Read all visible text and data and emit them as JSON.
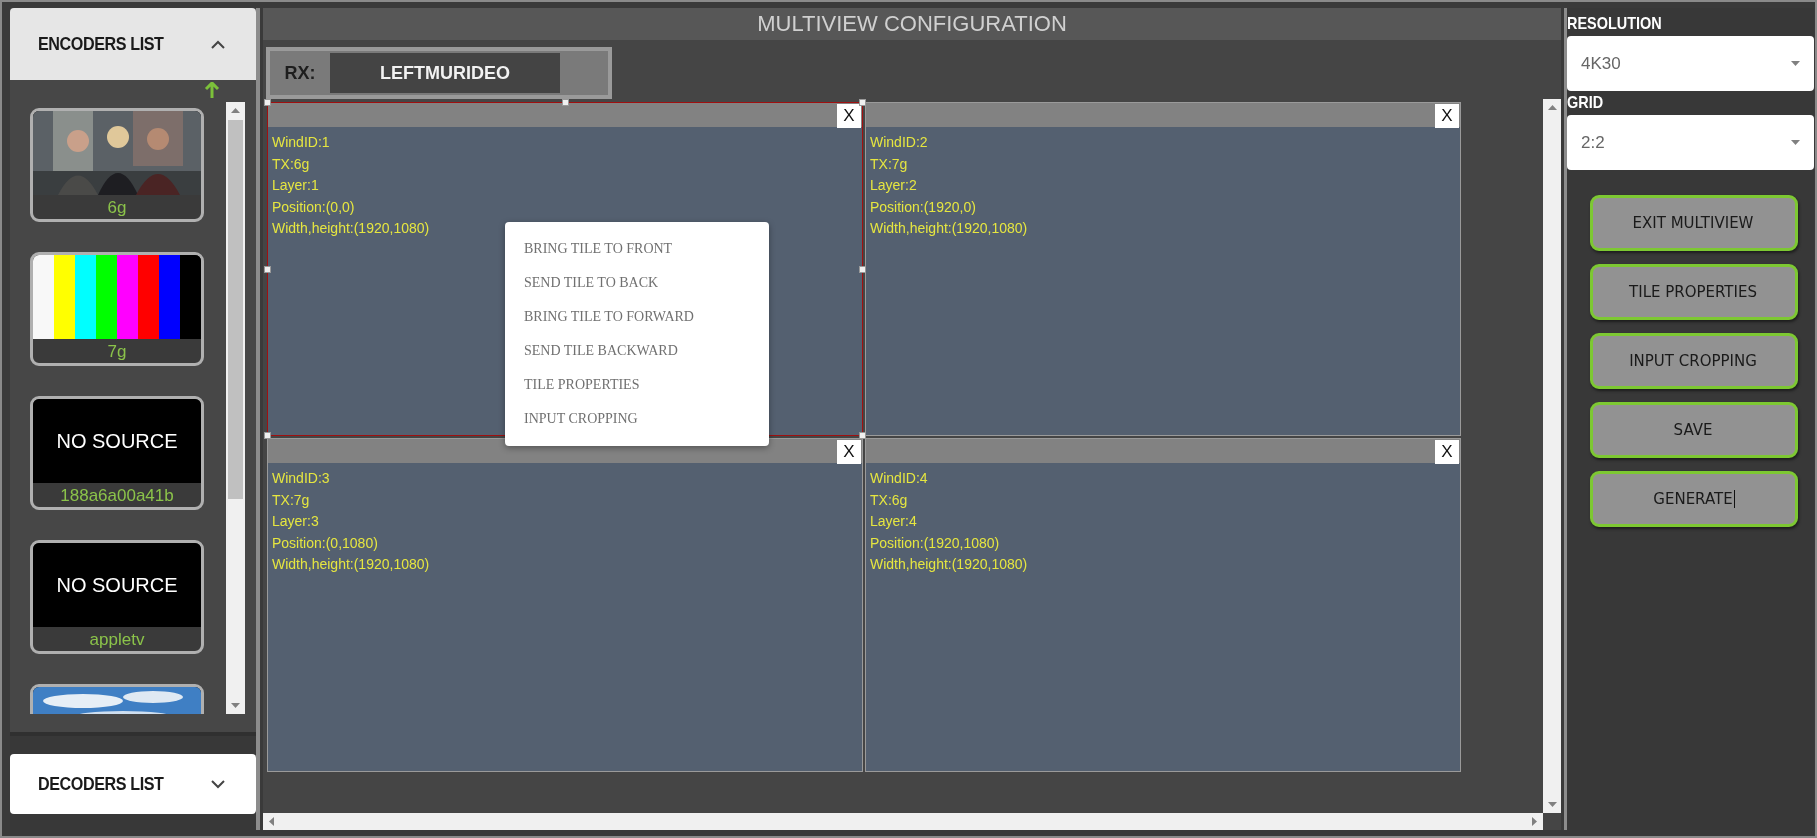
{
  "encoders_panel": {
    "title": "ENCODERS LIST",
    "expanded": true,
    "items": [
      {
        "kind": "picture",
        "label": "6g"
      },
      {
        "kind": "color_bars",
        "label": "7g"
      },
      {
        "kind": "no_source",
        "source_text": "NO SOURCE",
        "label": "188a6a00a41b"
      },
      {
        "kind": "no_source",
        "source_text": "NO SOURCE",
        "label": "appletv"
      },
      {
        "kind": "picture"
      }
    ]
  },
  "decoders_panel": {
    "title": "DECODERS LIST",
    "expanded": false
  },
  "title": "MULTIVIEW CONFIGURATION",
  "rx": {
    "label": "RX:",
    "value": "LEFTMURIDEO"
  },
  "tiles": [
    {
      "selected": true,
      "close": "X",
      "lines": [
        "WindID:1",
        "TX:6g",
        "Layer:1",
        "Position:(0,0)",
        "Width,height:(1920,1080)"
      ]
    },
    {
      "selected": false,
      "close": "X",
      "lines": [
        "WindID:2",
        "TX:7g",
        "Layer:2",
        "Position:(1920,0)",
        "Width,height:(1920,1080)"
      ]
    },
    {
      "selected": false,
      "close": "X",
      "lines": [
        "WindID:3",
        "TX:7g",
        "Layer:3",
        "Position:(0,1080)",
        "Width,height:(1920,1080)"
      ]
    },
    {
      "selected": false,
      "close": "X",
      "lines": [
        "WindID:4",
        "TX:6g",
        "Layer:4",
        "Position:(1920,1080)",
        "Width,height:(1920,1080)"
      ]
    }
  ],
  "context_menu": {
    "items": [
      "BRING TILE TO FRONT",
      "SEND TILE TO BACK",
      "BRING TILE TO FORWARD",
      "SEND TILE BACKWARD",
      "TILE PROPERTIES",
      "INPUT CROPPING"
    ]
  },
  "resolution": {
    "label": "RESOLUTION",
    "value": "4K30"
  },
  "grid": {
    "label": "GRID",
    "value": "2:2"
  },
  "buttons": [
    {
      "label": "EXIT MULTIVIEW",
      "focused": false
    },
    {
      "label": "TILE PROPERTIES",
      "focused": false
    },
    {
      "label": "INPUT CROPPING",
      "focused": false
    },
    {
      "label": "SAVE",
      "focused": false
    },
    {
      "label": "GENERATE",
      "focused": true
    }
  ]
}
